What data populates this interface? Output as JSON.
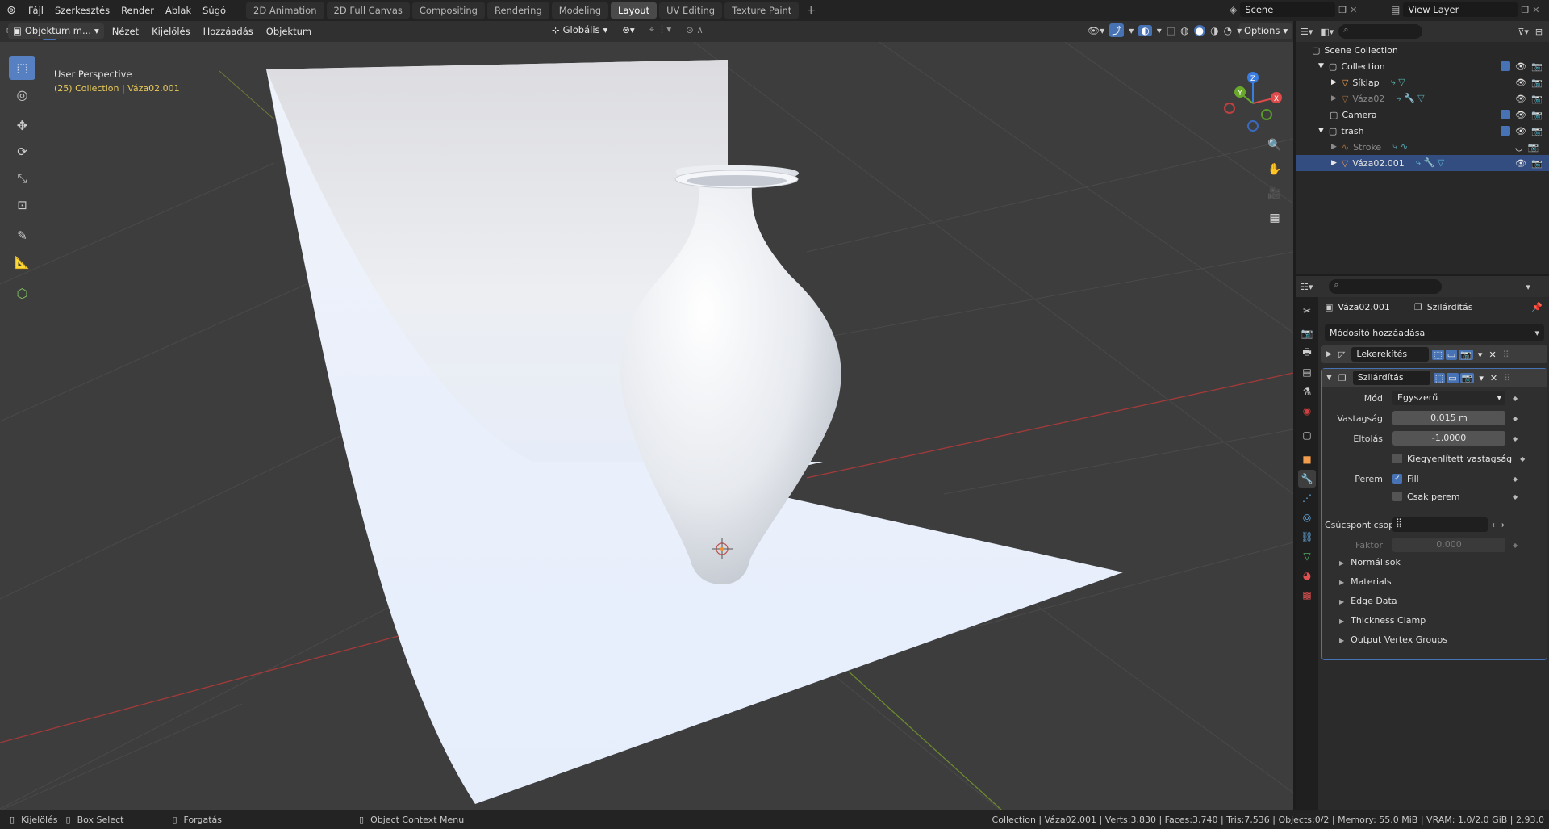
{
  "menu": {
    "items": [
      "Fájl",
      "Szerkesztés",
      "Render",
      "Ablak",
      "Súgó"
    ]
  },
  "workspaces": {
    "tabs": [
      "2D Animation",
      "2D Full Canvas",
      "Compositing",
      "Rendering",
      "Modeling",
      "Layout",
      "UV Editing",
      "Texture Paint"
    ],
    "active": "Layout",
    "add": "+"
  },
  "scene": {
    "name": "Scene",
    "view_layer": "View Layer"
  },
  "viewport_header": {
    "mode": "Objektum m...",
    "menus": [
      "Nézet",
      "Kijelölés",
      "Hozzáadás",
      "Objektum"
    ],
    "orientation": "Globális",
    "options": "Options"
  },
  "viewport": {
    "perspective": "User Perspective",
    "context": "(25) Collection | Váza02.001",
    "gizmo": {
      "x": "X",
      "y": "Y",
      "z": "Z"
    }
  },
  "outliner": {
    "scene_collection": "Scene Collection",
    "rows": [
      {
        "label": "Collection",
        "dim": false
      },
      {
        "label": "Síklap",
        "dim": false
      },
      {
        "label": "Váza02",
        "dim": true
      },
      {
        "label": "Camera",
        "dim": false
      },
      {
        "label": "trash",
        "dim": false
      },
      {
        "label": "Stroke",
        "dim": true
      },
      {
        "label": "Váza02.001",
        "dim": false
      }
    ]
  },
  "properties": {
    "breadcrumb_object": "Váza02.001",
    "breadcrumb_modifier": "Szilárdítás",
    "add_modifier": "Módosító hozzáadása",
    "modifier1": {
      "name": "Lekerekítés"
    },
    "modifier2": {
      "name": "Szilárdítás",
      "mode_label": "Mód",
      "mode_value": "Egyszerű",
      "thickness_label": "Vastagság",
      "thickness_value": "0.015 m",
      "offset_label": "Eltolás",
      "offset_value": "-1.0000",
      "even_label": "Kiegyenlített vastagság",
      "rim_label": "Perem",
      "fill_label": "Fill",
      "rim_only_label": "Csak perem",
      "vgroup_label": "Csúcspont csoport",
      "factor_label": "Faktor",
      "factor_value": "0.000",
      "subpanels": [
        "Normálisok",
        "Materials",
        "Edge Data",
        "Thickness Clamp",
        "Output Vertex Groups"
      ]
    }
  },
  "statusbar": {
    "select": "Kijelölés",
    "box_select": "Box Select",
    "rotate": "Forgatás",
    "context_menu": "Object Context Menu",
    "stats": "Collection | Váza02.001 | Verts:3,830 | Faces:3,740 | Tris:7,536 | Objects:0/2 | Memory: 55.0 MiB | VRAM: 1.0/2.0 GiB | 2.93.0"
  }
}
